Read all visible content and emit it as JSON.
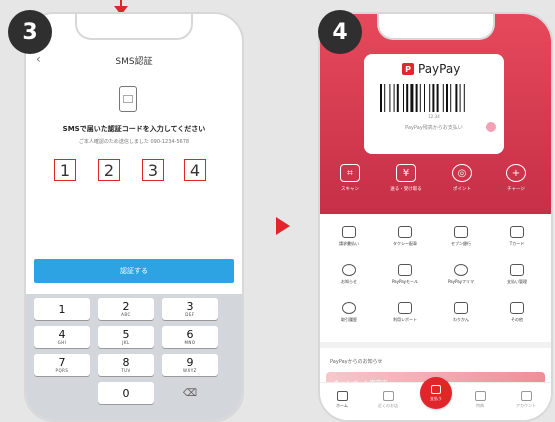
{
  "steps": {
    "step3": "3",
    "step4": "4"
  },
  "sms": {
    "back_icon": "chevron-left-icon",
    "header": "SMS認証",
    "title": "SMSで届いた認証コードを入力してください",
    "subtitle": "ご本人確認のため送信しました 090-1234-5678",
    "code": [
      "1",
      "2",
      "3",
      "4"
    ],
    "verify_label": "認証する",
    "accent": "#e0262b",
    "button_color": "#2ea3e4"
  },
  "keypad": {
    "keys": [
      {
        "num": "1",
        "sub": ""
      },
      {
        "num": "2",
        "sub": "ABC"
      },
      {
        "num": "3",
        "sub": "DEF"
      },
      {
        "num": "4",
        "sub": "GHI"
      },
      {
        "num": "5",
        "sub": "JKL"
      },
      {
        "num": "6",
        "sub": "MNO"
      },
      {
        "num": "7",
        "sub": "PQRS"
      },
      {
        "num": "8",
        "sub": "TUV"
      },
      {
        "num": "9",
        "sub": "WXYZ"
      },
      {
        "num": "0",
        "sub": ""
      }
    ],
    "delete_icon": "⌫"
  },
  "paypay": {
    "logo_text": "PayPay",
    "logo_glyph": "P",
    "barcode_number": "12:34",
    "card_caption": "PayPay残高からお支払い",
    "brand_color": "#e0262b",
    "actions": [
      {
        "label": "スキャン",
        "glyph": "⌗",
        "icon": "scan-icon"
      },
      {
        "label": "送る・受け取る",
        "glyph": "¥",
        "icon": "send-receive-icon"
      },
      {
        "label": "ポイント",
        "glyph": "◎",
        "icon": "points-icon"
      },
      {
        "label": "チャージ",
        "glyph": "+",
        "icon": "charge-icon"
      }
    ],
    "services": [
      {
        "label": "請求書払い",
        "icon": "bill-icon"
      },
      {
        "label": "タクシー配車",
        "icon": "taxi-icon"
      },
      {
        "label": "セブン銀行",
        "icon": "atm-icon"
      },
      {
        "label": "Tカード",
        "icon": "t-card-icon"
      },
      {
        "label": "お知らせ",
        "icon": "bell-icon"
      },
      {
        "label": "PayPayモール",
        "icon": "mall-icon"
      },
      {
        "label": "PayPayフリマ",
        "icon": "flea-market-icon"
      },
      {
        "label": "支払い管理",
        "icon": "payment-history-icon"
      },
      {
        "label": "取引履歴",
        "icon": "history-icon"
      },
      {
        "label": "利用レポート",
        "icon": "report-icon"
      },
      {
        "label": "わりかん",
        "icon": "split-bill-icon"
      },
      {
        "label": "その他",
        "icon": "more-grid-icon"
      }
    ],
    "info_title": "PayPayからのお知らせ",
    "banner_text": "キャンペーン実施中",
    "tabs": [
      {
        "label": "ホーム",
        "icon": "home-icon"
      },
      {
        "label": "近くのお店",
        "icon": "nearby-shops-icon"
      },
      {
        "label": "支払う",
        "icon": "pay-icon"
      },
      {
        "label": "特典",
        "icon": "coupon-icon"
      },
      {
        "label": "アカウント",
        "icon": "account-icon"
      }
    ]
  }
}
